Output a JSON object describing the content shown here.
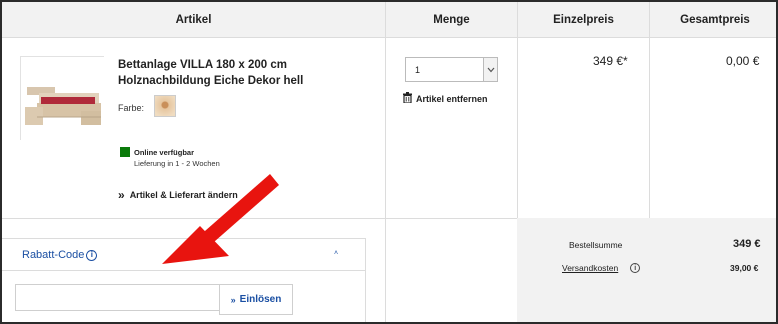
{
  "table": {
    "headers": [
      "Artikel",
      "Menge",
      "Einzelpreis",
      "Gesamtpreis"
    ]
  },
  "product": {
    "name": "Bettanlage VILLA 180 x 200 cm Holznachbildung Eiche Dekor hell",
    "color_label": "Farbe:",
    "availability": "Online verfügbar",
    "delivery": "Lieferung in 1 - 2 Wochen",
    "change_link": "Artikel & Lieferart ändern",
    "change_icon": "»"
  },
  "quantity": {
    "value": "1",
    "remove_label": "Artikel entfernen"
  },
  "prices": {
    "unit": "349 €*",
    "total": "0,00 €"
  },
  "summary": {
    "order_total_label": "Bestellsumme",
    "order_total_value": "349 €",
    "shipping_label": "Versandkosten",
    "shipping_value": "39,00 €"
  },
  "coupon": {
    "title": "Rabatt-Code",
    "info_icon": "i",
    "input_value": "",
    "redeem_label": "Einlösen",
    "redeem_icon": "»",
    "collapse_icon": "˄"
  },
  "colors": {
    "accent": "#1a4fa3",
    "available": "#0a7a0a",
    "annotation_arrow": "#e8140f",
    "header_bg": "#f2f2f2"
  }
}
